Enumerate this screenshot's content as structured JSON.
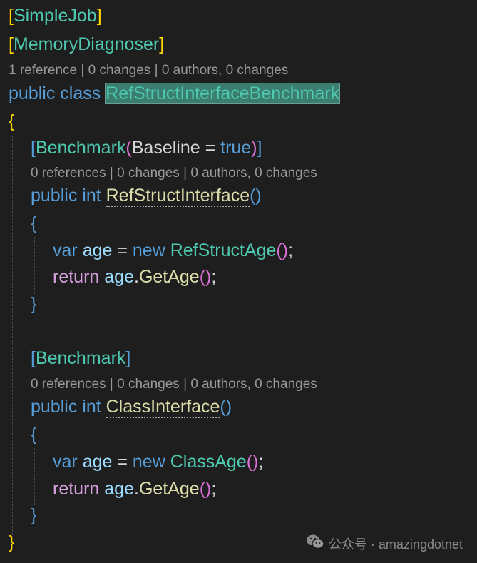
{
  "editor": {
    "lines": [
      {
        "kind": "code",
        "indent": 0,
        "tokens": [
          [
            "[",
            "br"
          ],
          [
            "SimpleJob",
            "ty"
          ],
          [
            "]",
            "br"
          ]
        ]
      },
      {
        "kind": "code",
        "indent": 0,
        "tokens": [
          [
            "[",
            "br"
          ],
          [
            "MemoryDiagnoser",
            "ty"
          ],
          [
            "]",
            "br"
          ]
        ]
      },
      {
        "kind": "lens",
        "indent": 0,
        "tokens": [
          [
            "1 reference",
            "lens"
          ],
          [
            " | ",
            "sep"
          ],
          [
            "0 changes",
            "lens"
          ],
          [
            " | ",
            "sep"
          ],
          [
            "0 authors, 0 changes",
            "lens"
          ]
        ]
      },
      {
        "kind": "code",
        "indent": 0,
        "tokens": [
          [
            "public class ",
            "kw"
          ],
          [
            "RefStructInterfaceBenchmark",
            "ty hl"
          ]
        ]
      },
      {
        "kind": "code",
        "indent": 0,
        "tokens": [
          [
            "{",
            "br"
          ]
        ]
      },
      {
        "kind": "code",
        "indent": 1,
        "tokens": [
          [
            "[",
            "kw"
          ],
          [
            "Benchmark",
            "ty"
          ],
          [
            "(",
            "p2"
          ],
          [
            "Baseline = ",
            "pl"
          ],
          [
            "true",
            "kw"
          ],
          [
            ")",
            "p2"
          ],
          [
            "]",
            "kw"
          ]
        ]
      },
      {
        "kind": "lens",
        "indent": 1,
        "tokens": [
          [
            "0 references",
            "lens"
          ],
          [
            " | ",
            "sep"
          ],
          [
            "0 changes",
            "lens"
          ],
          [
            " | ",
            "sep"
          ],
          [
            "0 authors, 0 changes",
            "lens"
          ]
        ]
      },
      {
        "kind": "code",
        "indent": 1,
        "tokens": [
          [
            "public int ",
            "kw"
          ],
          [
            "RefStructInterface",
            "fn dots"
          ],
          [
            "()",
            "kw"
          ]
        ]
      },
      {
        "kind": "code",
        "indent": 1,
        "tokens": [
          [
            "{",
            "kw"
          ]
        ]
      },
      {
        "kind": "code",
        "indent": 2,
        "tokens": [
          [
            "var ",
            "kw"
          ],
          [
            "age",
            "var"
          ],
          [
            " = ",
            "pl"
          ],
          [
            "new ",
            "kw"
          ],
          [
            "RefStructAge",
            "ty"
          ],
          [
            "()",
            "p2"
          ],
          [
            ";",
            "pl"
          ]
        ]
      },
      {
        "kind": "code",
        "indent": 2,
        "tokens": [
          [
            "return ",
            "ctl"
          ],
          [
            "age",
            "var"
          ],
          [
            ".",
            "pl"
          ],
          [
            "GetAge",
            "fn"
          ],
          [
            "()",
            "p2"
          ],
          [
            ";",
            "pl"
          ]
        ]
      },
      {
        "kind": "code",
        "indent": 1,
        "tokens": [
          [
            "}",
            "kw"
          ]
        ]
      },
      {
        "kind": "code",
        "indent": 0,
        "tokens": []
      },
      {
        "kind": "code",
        "indent": 1,
        "tokens": [
          [
            "[",
            "kw"
          ],
          [
            "Benchmark",
            "ty"
          ],
          [
            "]",
            "kw"
          ]
        ]
      },
      {
        "kind": "lens",
        "indent": 1,
        "tokens": [
          [
            "0 references",
            "lens"
          ],
          [
            " | ",
            "sep"
          ],
          [
            "0 changes",
            "lens"
          ],
          [
            " | ",
            "sep"
          ],
          [
            "0 authors, 0 changes",
            "lens"
          ]
        ]
      },
      {
        "kind": "code",
        "indent": 1,
        "tokens": [
          [
            "public int ",
            "kw"
          ],
          [
            "ClassInterface",
            "fn dots"
          ],
          [
            "()",
            "kw"
          ]
        ]
      },
      {
        "kind": "code",
        "indent": 1,
        "tokens": [
          [
            "{",
            "kw"
          ]
        ]
      },
      {
        "kind": "code",
        "indent": 2,
        "tokens": [
          [
            "var ",
            "kw"
          ],
          [
            "age",
            "var"
          ],
          [
            " = ",
            "pl"
          ],
          [
            "new ",
            "kw"
          ],
          [
            "ClassAge",
            "ty"
          ],
          [
            "()",
            "p2"
          ],
          [
            ";",
            "pl"
          ]
        ]
      },
      {
        "kind": "code",
        "indent": 2,
        "tokens": [
          [
            "return ",
            "ctl"
          ],
          [
            "age",
            "var"
          ],
          [
            ".",
            "pl"
          ],
          [
            "GetAge",
            "fn"
          ],
          [
            "()",
            "p2"
          ],
          [
            ";",
            "pl"
          ]
        ]
      },
      {
        "kind": "code",
        "indent": 1,
        "tokens": [
          [
            "}",
            "kw"
          ]
        ]
      },
      {
        "kind": "code",
        "indent": 0,
        "tokens": [
          [
            "}",
            "br"
          ]
        ]
      }
    ]
  },
  "watermark": {
    "icon": "wechat-icon",
    "text": "公众号 · amazingdotnet"
  }
}
